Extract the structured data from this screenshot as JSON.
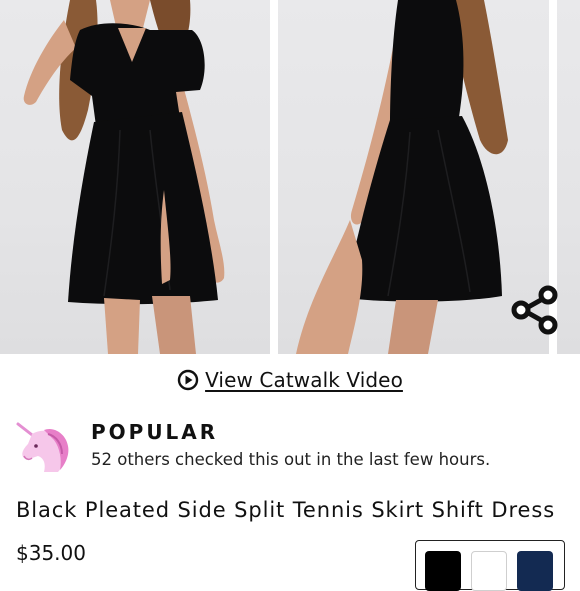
{
  "gallery": {
    "colors": {
      "background": "#e6e6e8",
      "dress": "#0c0c0d",
      "skin": "#d4a184",
      "hair": "#8a5a36"
    }
  },
  "share": {
    "icon": "share-icon"
  },
  "catwalk": {
    "icon": "play-circle-icon",
    "label": "View Catwalk Video"
  },
  "popular": {
    "icon": "unicorn-icon",
    "title": "POPULAR",
    "text": "52 others checked this out in the last few hours."
  },
  "product": {
    "title": "Black Pleated Side Split Tennis Skirt Shift Dress",
    "price": "$35.00"
  },
  "colors": {
    "swatches": [
      "#000000",
      "#ffffff",
      "#132a52"
    ]
  }
}
